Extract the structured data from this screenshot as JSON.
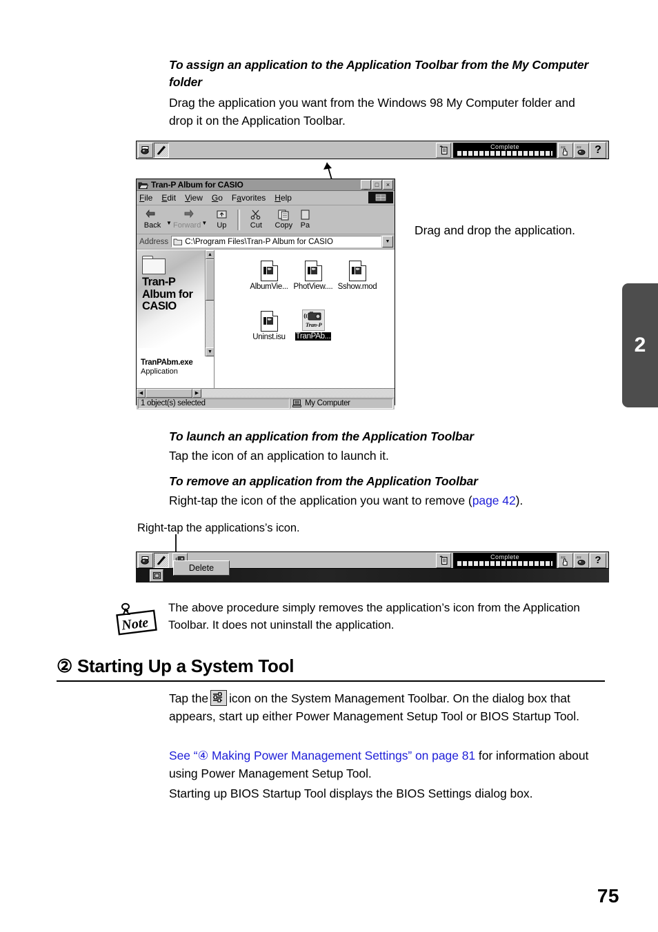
{
  "page": {
    "number": "75",
    "chapter_tab": "2"
  },
  "sections": [
    {
      "heading": "To assign an application to the Application Toolbar from the My Computer folder",
      "body": "Drag the application you want from the Windows 98 My Computer folder and drop it on the Application Toolbar."
    },
    {
      "heading": "To launch an application from the Application Toolbar",
      "body": "Tap the icon of an application to launch it."
    },
    {
      "heading": "To remove an application from the Application Toolbar",
      "body_pre": "Right-tap the icon of the application you want to remove (",
      "body_link": "page 42",
      "body_post": ")."
    }
  ],
  "annotations": {
    "drag_drop": "Drag and drop the application.",
    "right_tap": "Right-tap the applications’s icon."
  },
  "note": {
    "label": "Note",
    "text": "The above procedure simply removes the application’s icon from the Application Toolbar. It does not uninstall the application."
  },
  "system_tool": {
    "heading_number": "②",
    "heading": "Starting Up a System Tool",
    "para1_pre": "Tap the",
    "para1_post": "icon on the System Management Toolbar. On the dialog box that appears, start up either Power Management Setup Tool or BIOS Startup Tool.",
    "link_text": "See “④ Making Power Management Settings” on page 81",
    "para2_post": " for information about using Power Management Setup Tool.",
    "para3": "Starting up BIOS Startup Tool displays the BIOS Settings dialog box."
  },
  "app_toolbar": {
    "status_label": "Complete",
    "buttons_left": [
      "printer-icon",
      "pen-icon"
    ],
    "buttons_right": [
      "clipboard-icon",
      "suspend-hand-icon",
      "suspend-mouse-icon",
      "help-icon"
    ],
    "help_label": "?",
    "delete_menu_label": "Delete"
  },
  "explorer": {
    "title": "Tran-P Album for CASIO",
    "title_buttons": [
      "_",
      "□",
      "×"
    ],
    "menus": [
      {
        "pre": "",
        "key": "F",
        "post": "ile"
      },
      {
        "pre": "",
        "key": "E",
        "post": "dit"
      },
      {
        "pre": "",
        "key": "V",
        "post": "iew"
      },
      {
        "pre": "",
        "key": "G",
        "post": "o"
      },
      {
        "pre": "",
        "key": "F",
        "post": "avorites"
      },
      {
        "pre": "",
        "key": "H",
        "post": "elp"
      }
    ],
    "toolbar_buttons": [
      {
        "label": "Back",
        "disabled": false,
        "caret": true
      },
      {
        "label": "Forward",
        "disabled": true,
        "caret": true
      },
      {
        "label": "Up",
        "disabled": false,
        "caret": false
      },
      {
        "label": "Cut",
        "disabled": false,
        "caret": false
      },
      {
        "label": "Copy",
        "disabled": false,
        "caret": false
      },
      {
        "label": "Pa",
        "disabled": false,
        "caret": false
      }
    ],
    "address_label": "Address",
    "address_value": "C:\\Program Files\\Tran-P Album for CASIO",
    "left_pane": {
      "title": "Tran-P Album for CASIO",
      "selected_file": "TranPAbm.exe",
      "selected_type": "Application"
    },
    "files": [
      {
        "name": "AlbumVie...",
        "type": "doc",
        "selected": false
      },
      {
        "name": "PhotView....",
        "type": "doc",
        "selected": false
      },
      {
        "name": "Sshow.mod",
        "type": "doc",
        "selected": false
      },
      {
        "name": "Uninst.isu",
        "type": "doc",
        "selected": false
      },
      {
        "name": "TranPAb...",
        "type": "app",
        "selected": true,
        "icon_caption": "Tran-P"
      }
    ],
    "status_left": "1 object(s) selected",
    "status_right": "My Computer"
  },
  "colors": {
    "link": "#2020d8",
    "chapter_tab_bg": "#4d4d4d",
    "window_face": "#c0c0c0"
  }
}
